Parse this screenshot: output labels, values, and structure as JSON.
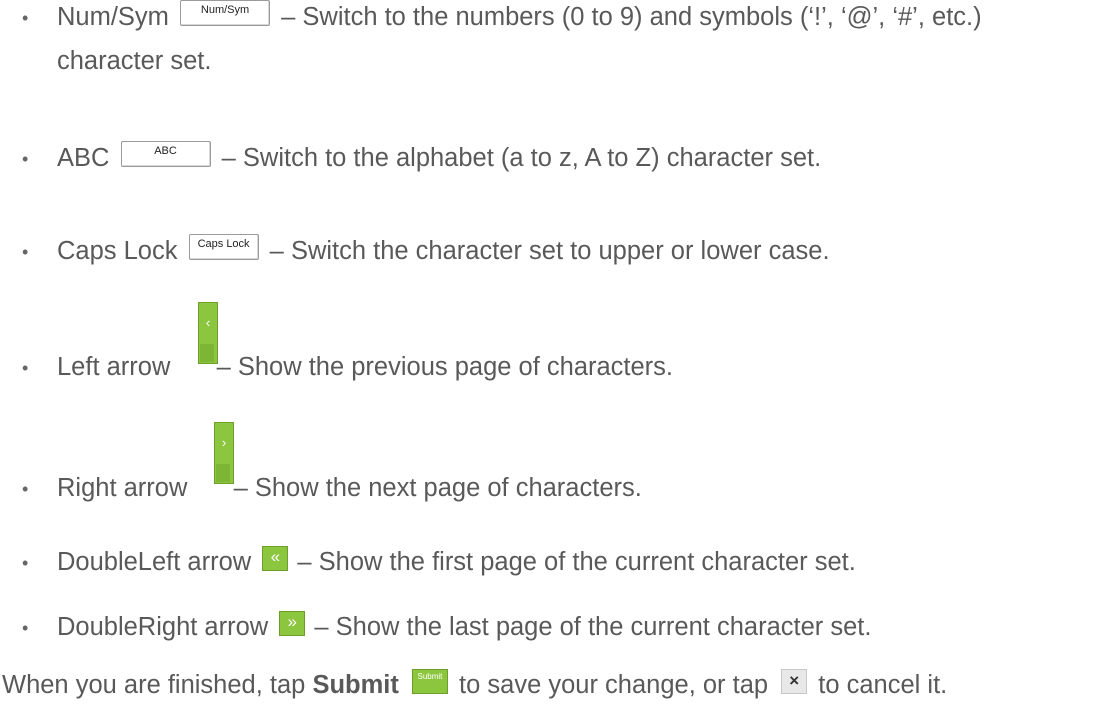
{
  "items": [
    {
      "name": "Num/Sym",
      "key_label": "Num/Sym",
      "desc": "– Switch to the numbers (0 to 9) and symbols (‘!’, ‘@’, ‘#’, etc.)",
      "desc2": "character set."
    },
    {
      "name": "ABC",
      "key_label": "ABC",
      "desc": "– Switch to the alphabet (a to z, A to Z) character set."
    },
    {
      "name": "Caps Lock",
      "key_label": "Caps Lock",
      "desc": "– Switch the character set to upper or lower case."
    },
    {
      "name": "Left arrow",
      "key_label": "‹",
      "desc": "– Show the previous page of characters."
    },
    {
      "name": "Right arrow",
      "key_label": "›",
      "desc": "– Show the next page of characters."
    },
    {
      "name": "DoubleLeft arrow",
      "key_label": "«",
      "desc": "– Show the first page of the current character set."
    },
    {
      "name": "DoubleRight arrow",
      "key_label": "»",
      "desc": "– Show the last page of the current character set."
    }
  ],
  "footer": {
    "prefix": "When you are finished, tap ",
    "bold": "Submit",
    "submit_key_label": "Submit",
    "middle": " to save your change, or tap ",
    "close_key_label": "×",
    "suffix": " to cancel it."
  },
  "colors": {
    "text": "#595959",
    "key_green": "#8cc63f"
  }
}
